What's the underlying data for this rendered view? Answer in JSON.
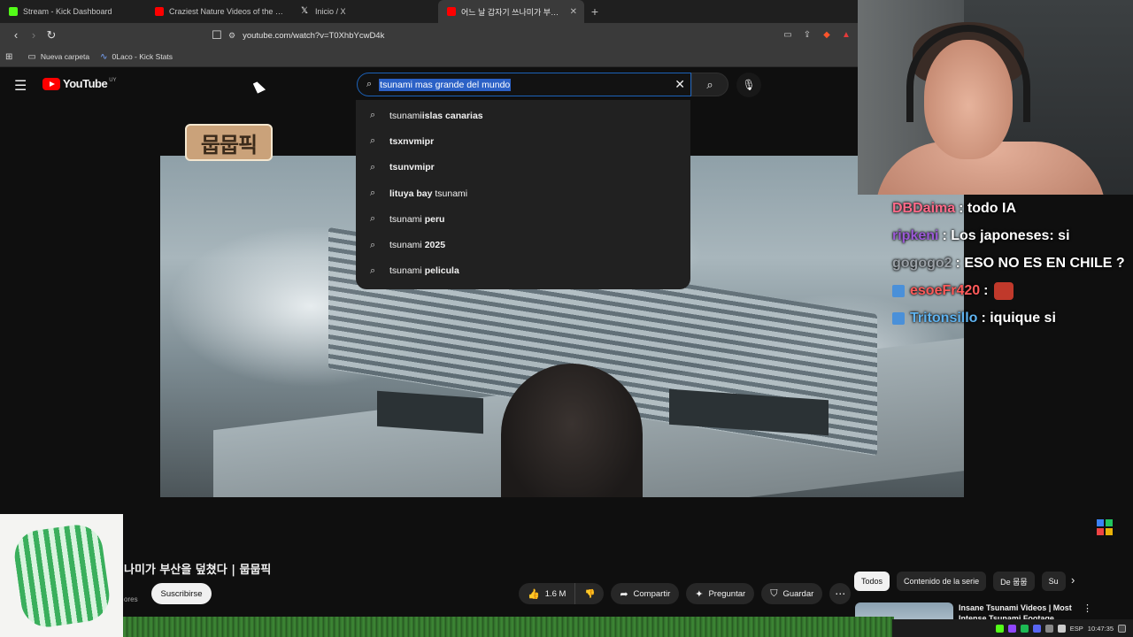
{
  "browser": {
    "tabs": [
      {
        "label": "Stream - Kick Dashboard",
        "favicon_color": "#53fc18"
      },
      {
        "label": "Craziest Nature Videos of the Decade",
        "favicon_color": "#ff0000"
      },
      {
        "label": "Inicio / X",
        "favicon_color": "#ffffff"
      },
      {
        "label": "어느 날 갑자기 쓰나미가 부산을",
        "favicon_color": "#ff0000",
        "close": "✕"
      }
    ],
    "new_tab": "+",
    "url": "youtube.com/watch?v=T0XhbYcwD4k",
    "bookmarks": [
      {
        "label": "Nueva carpeta",
        "icon": "folder-icon"
      },
      {
        "label": "0Laco - Kick Stats",
        "icon": "chart-icon"
      }
    ]
  },
  "youtube": {
    "logo_text": "YouTube",
    "country_code": "UY",
    "search_query": "tsunami mas grande del mundo",
    "suggestions": [
      {
        "prefix": "tsunami ",
        "bold": "islas canarias"
      },
      {
        "prefix": "",
        "bold": "tsxnvmipr"
      },
      {
        "prefix": "",
        "bold": "tsunvmipr"
      },
      {
        "prefix": "",
        "bold": "lituya bay",
        "suffix": " tsunami"
      },
      {
        "prefix": "tsunami ",
        "bold": "peru"
      },
      {
        "prefix": "tsunami ",
        "bold": "2025"
      },
      {
        "prefix": "tsunami ",
        "bold": "pelicula"
      }
    ],
    "channel_badge": "뭅뭅픽",
    "video_title": "나미가 부산을 덮쳤다 | 뭅뭅픽",
    "subscribers_fragment": "ores",
    "subscribe_label": "Suscribirse",
    "likes": "1.6 M",
    "share_label": "Compartir",
    "ask_label": "Preguntar",
    "save_label": "Guardar",
    "chips": [
      "Todos",
      "Contenido de la serie",
      "De 뭅뭅",
      "Su"
    ],
    "recommendation_title": "Insane Tsunami Videos | Most Intense Tsunami Footage"
  },
  "chat": [
    {
      "user": "DBDaima",
      "user_color": "#ff6b8a",
      "message": ": todo IA"
    },
    {
      "user": "ripkeni",
      "user_color": "#9b59d6",
      "message": ": Los japoneses: si"
    },
    {
      "user": "gogogo2",
      "user_color": "#9aa0a6",
      "message": ": ESO NO ES EN CHILE ?"
    },
    {
      "user": "esoeFr420",
      "user_color": "#ff5a5a",
      "message": ":",
      "badge": true,
      "emote": true
    },
    {
      "user": "Tritonsillo",
      "user_color": "#5fb3f0",
      "message": ": iquique si",
      "badge": true
    }
  ],
  "taskbar": {
    "language": "ESP",
    "time": "10:47:35"
  }
}
